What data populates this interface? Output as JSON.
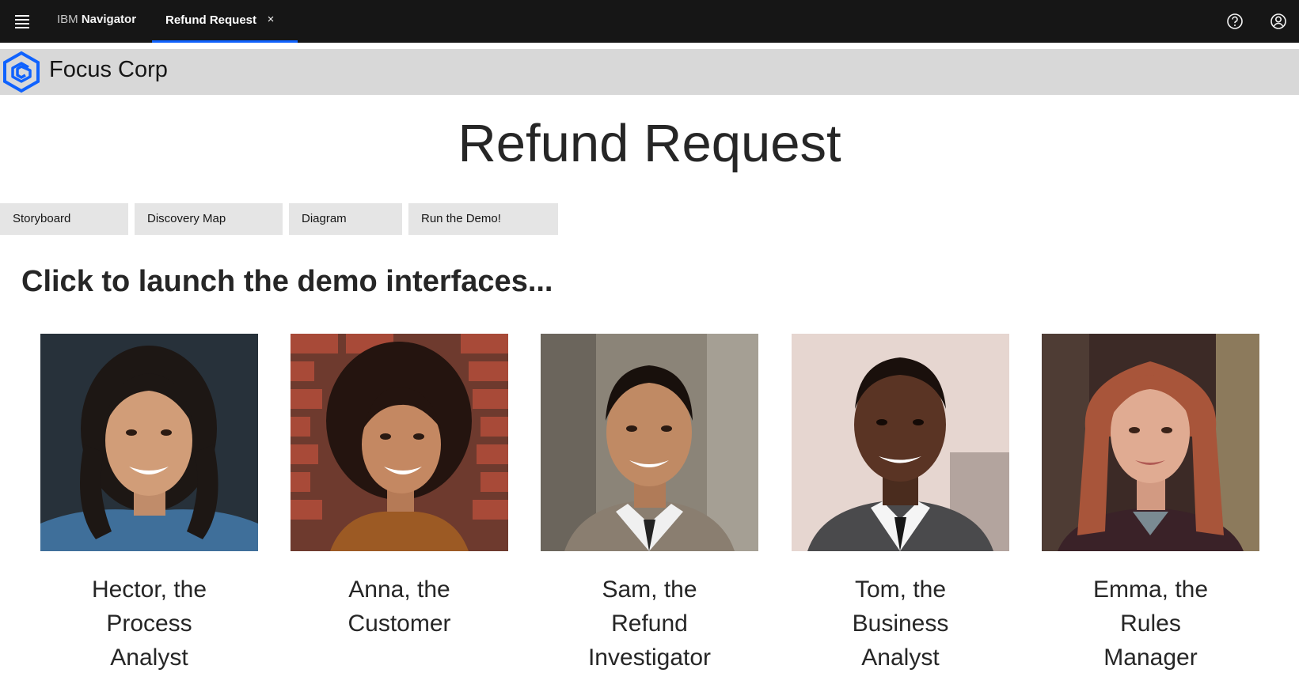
{
  "shell": {
    "brand_prefix": "IBM",
    "brand_name": "Navigator",
    "tab_label": "Refund Request",
    "tab_close": "×"
  },
  "company": {
    "name": "Focus Corp"
  },
  "page": {
    "title": "Refund Request",
    "heading": "Click to launch the demo interfaces..."
  },
  "nav_buttons": [
    "Storyboard",
    "Discovery Map",
    "Diagram",
    "Run the Demo!"
  ],
  "personas": [
    {
      "lines": [
        "Hector, the",
        "Process",
        "Analyst"
      ]
    },
    {
      "lines": [
        "Anna, the",
        "Customer"
      ]
    },
    {
      "lines": [
        "Sam, the",
        "Refund",
        "Investigator"
      ]
    },
    {
      "lines": [
        "Tom, the",
        "Business",
        "Analyst"
      ]
    },
    {
      "lines": [
        "Emma, the",
        "Rules",
        "Manager"
      ]
    }
  ],
  "colors": {
    "shell_bg": "#161616",
    "accent": "#0f62fe",
    "company_band": "#d8d8d8",
    "nav_button_bg": "#e5e5e5"
  },
  "icons": [
    "menu-icon",
    "close-icon",
    "help-icon",
    "user-avatar-icon",
    "focus-corp-logo"
  ]
}
